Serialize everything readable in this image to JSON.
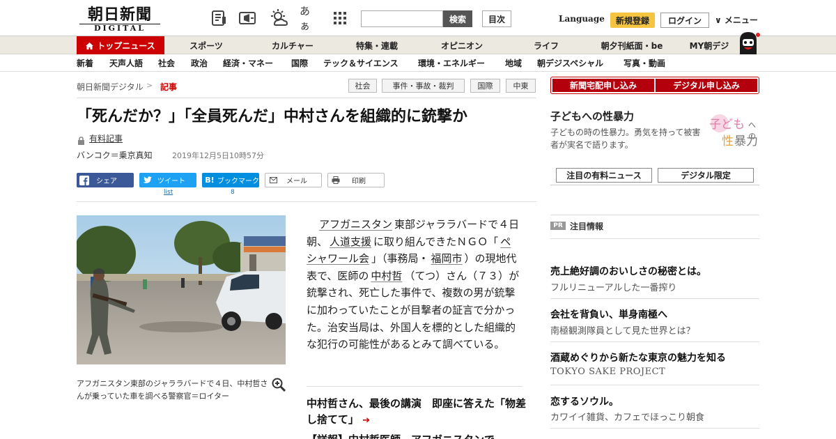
{
  "header": {
    "logo_main": "朝日新聞",
    "logo_sub": "DIGITAL",
    "search_placeholder": "",
    "search_button": "検索",
    "toc_button": "目次",
    "language": "Language",
    "register": "新規登録",
    "login": "ログイン",
    "menu": "∨ メニュー",
    "font_size_glyph": "あぁ",
    "icons": [
      "newspaper-icon",
      "megaphone-icon",
      "weather-icon",
      "font-size-icon",
      "grid-icon"
    ]
  },
  "nav_primary": [
    {
      "label": "トップニュース",
      "active": true
    },
    {
      "label": "スポーツ"
    },
    {
      "label": "カルチャー"
    },
    {
      "label": "特集・連載"
    },
    {
      "label": "オピニオン"
    },
    {
      "label": "ライフ"
    },
    {
      "label": "朝夕刊紙面・be"
    },
    {
      "label": "MY朝デジ"
    }
  ],
  "nav_secondary": [
    "新着",
    "天声人語",
    "社会",
    "政治",
    "経済・マネー",
    "国際",
    "テック＆サイエンス",
    "環境・エネルギー",
    "地域",
    "朝デジスペシャル",
    "写真・動画"
  ],
  "breadcrumb": {
    "home": "朝日新聞デジタル",
    "current": "記事",
    "separator": ">"
  },
  "tags": [
    "社会",
    "事件・事故・裁判",
    "国際",
    "中東"
  ],
  "article": {
    "headline": "「死んだか？」「全員死んだ」中村さんを組織的に銃撃か",
    "paid_label": "有料記事",
    "byline": "バンコク＝乗京真知",
    "date": "2019年12月5日10時57分",
    "photo_caption": "アフガニスタン東部のジャララバードで４日、中村哲さんが乗っていた車を調べる警察官＝ロイター",
    "body": [
      {
        "t": "アフガニスタン",
        "k": true
      },
      {
        "t": "東部ジャララバードで４日朝、"
      },
      {
        "t": "人道支援",
        "k": true
      },
      {
        "t": "に取り組んできたＮＧＯ「"
      },
      {
        "t": "ペシャワール会",
        "k": true
      },
      {
        "t": "」（事務局・"
      },
      {
        "t": "福岡市",
        "k": true
      },
      {
        "t": "）の現地代表で、医師の"
      },
      {
        "t": "中村哲",
        "k": true
      },
      {
        "t": "（てつ）さん（７３）が銃撃され、死亡した事件で、複数の男が銃撃に加わっていたことが目撃者の証言で分かった。治安当局は、外国人を標的とした組織的な犯行の可能性があるとみて調べている。"
      }
    ],
    "related_title": "中村哲さん、最後の講演　即座に答えた「物差し捨てて」",
    "related_arrow": "➔",
    "related_next": "【詳報】中村哲医師　アフガニスタンで"
  },
  "share": {
    "facebook": "シェア",
    "twitter": "ツイート",
    "twitter_count": "list",
    "hatena_glyph": "B!",
    "hatena": "ブックマーク",
    "hatena_count": "8",
    "mail": "メール",
    "print": "印刷"
  },
  "sidebar": {
    "subscribe_paper": "新聞宅配申し込み",
    "subscribe_digital": "デジタル申し込み",
    "feature_title": "子どもへの性暴力",
    "feature_desc": "子どもの時の性暴力。勇気を持って被害者が実名で語ります。",
    "feature_logo": {
      "l1": "子ども",
      "l1b": "への",
      "l2a": "性",
      "l2b": "暴力"
    },
    "tab_paid": "注目の有料ニュース",
    "tab_digital": "デジタル限定",
    "pr_badge": "PR",
    "pr_title": "注目情報",
    "ads": [
      {
        "title": "売上絶好調のおいしさの秘密とは。",
        "sub": "フルリニューアルした一番搾り"
      },
      {
        "title": "会社を背負い、単身南極へ",
        "sub": "南極観測隊員として見た世界とは？"
      },
      {
        "title": "酒蔵めぐりから新たな東京の魅力を知る",
        "sub": "TOKYO SAKE PROJECT"
      },
      {
        "title": "恋するソウル。",
        "sub": "カワイイ雑貨、カフェでほっこり朝食"
      }
    ]
  },
  "colors": {
    "brand_red": "#c00",
    "nav_bg": "#ece9e1",
    "register_yellow": "#f5c542",
    "facebook": "#3b5998",
    "twitter": "#1da1f2",
    "hatena": "#008fde"
  }
}
